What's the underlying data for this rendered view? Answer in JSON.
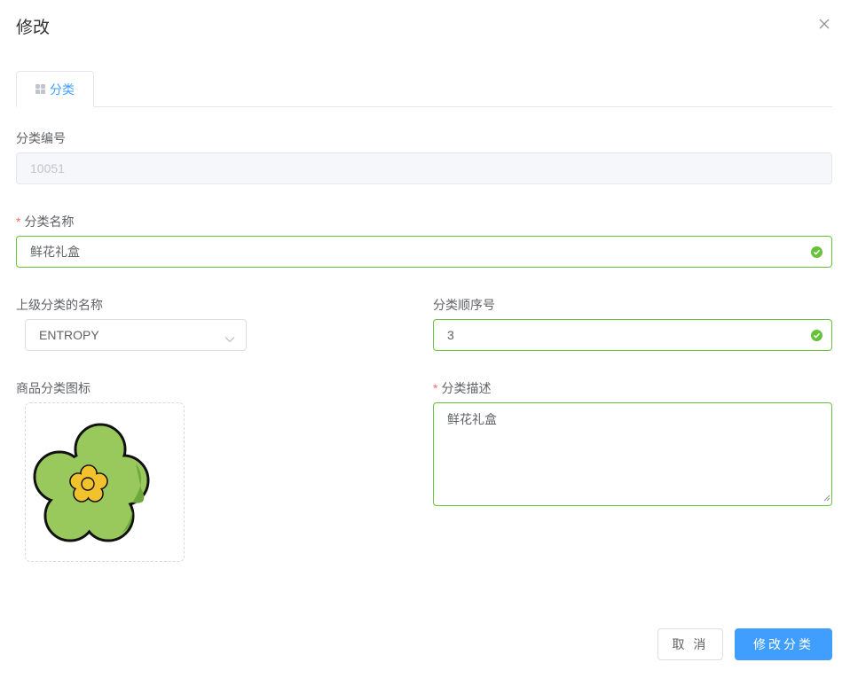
{
  "dialog": {
    "title": "修改"
  },
  "tabs": [
    {
      "label": "分类",
      "icon": "grid-icon",
      "active": true
    }
  ],
  "form": {
    "category_id": {
      "label": "分类编号",
      "value": "10051",
      "disabled": true
    },
    "category_name": {
      "label": "分类名称",
      "required": true,
      "value": "鲜花礼盒",
      "validated": true
    },
    "parent_category": {
      "label": "上级分类的名称",
      "value": "ENTROPY"
    },
    "sort_order": {
      "label": "分类顺序号",
      "value": "3",
      "validated": true
    },
    "icon": {
      "label": "商品分类图标",
      "image": "flower-image"
    },
    "description": {
      "label": "分类描述",
      "required": true,
      "value": "鲜花礼盒"
    }
  },
  "buttons": {
    "cancel": "取 消",
    "submit": "修改分类"
  },
  "colors": {
    "primary": "#409eff",
    "success": "#67c23a",
    "required": "#f56c6c"
  }
}
